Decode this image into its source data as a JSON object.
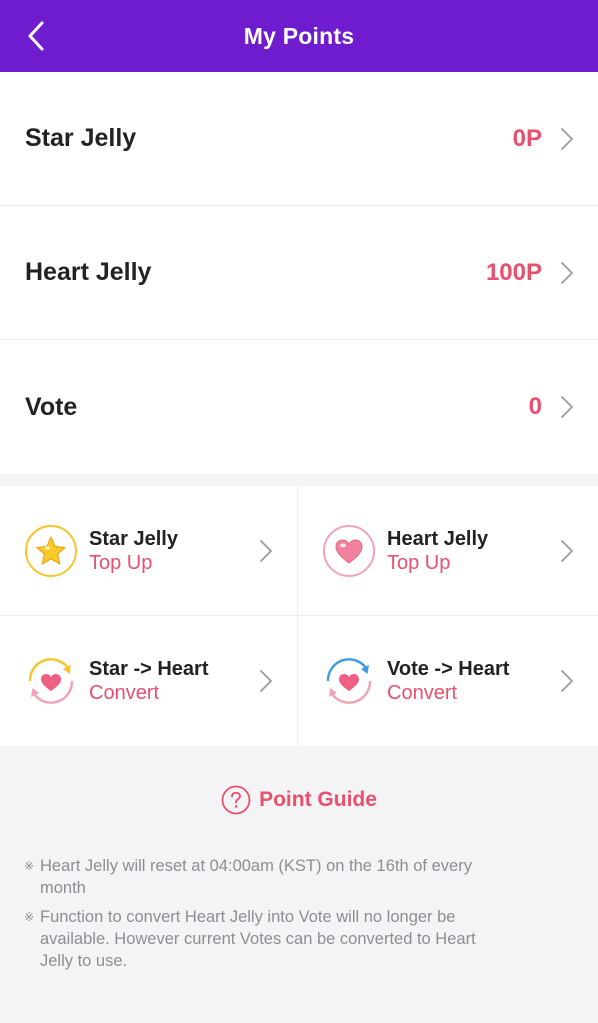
{
  "header": {
    "title": "My Points",
    "back_icon": "chevron-left-icon"
  },
  "points": [
    {
      "label": "Star Jelly",
      "value": "0P"
    },
    {
      "label": "Heart Jelly",
      "value": "100P"
    },
    {
      "label": "Vote",
      "value": "0"
    }
  ],
  "actions": [
    {
      "title": "Star Jelly",
      "subtitle": "Top Up",
      "icon": "star-jelly-icon"
    },
    {
      "title": "Heart Jelly",
      "subtitle": "Top Up",
      "icon": "heart-jelly-icon"
    },
    {
      "title": "Star -> Heart",
      "subtitle": "Convert",
      "icon": "star-to-heart-convert-icon"
    },
    {
      "title": "Vote -> Heart",
      "subtitle": "Convert",
      "icon": "vote-to-heart-convert-icon"
    }
  ],
  "guide": {
    "label": "Point Guide",
    "icon": "question-circle-icon"
  },
  "notes": [
    {
      "mark": "※",
      "text": "Heart Jelly will reset at 04:00am (KST) on the 16th of every month"
    },
    {
      "mark": "※",
      "text": "Function to convert Heart Jelly into Vote will no longer be available. However current Votes can be converted to Heart Jelly to use."
    }
  ],
  "colors": {
    "header_bg": "#6f1bce",
    "accent": "#e8506e",
    "star_yellow": "#f3c52b",
    "vote_blue": "#3f9be6"
  }
}
